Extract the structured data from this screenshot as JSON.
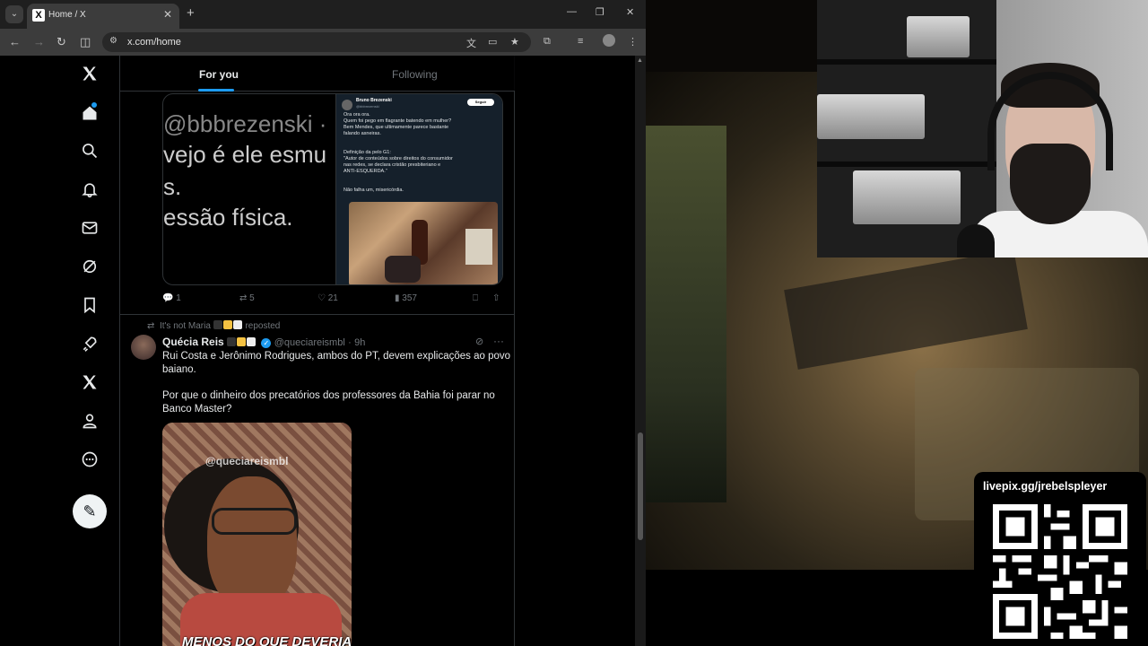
{
  "browser": {
    "tab_title": "Home / X",
    "tab_favicon": "X",
    "new_tab": "+",
    "url": "x.com/home",
    "window_controls": {
      "minimize": "—",
      "maximize": "❐",
      "close": "✕"
    }
  },
  "x": {
    "tabs": {
      "for_you": "For you",
      "following": "Following"
    },
    "nav_icons": [
      "x-logo-icon",
      "home-icon",
      "search-icon",
      "bell-icon",
      "mail-icon",
      "grok-icon",
      "bookmark-icon",
      "rocket-icon",
      "premium-x-icon",
      "profile-icon",
      "more-icon"
    ],
    "compose_icon": "feather-plus-icon",
    "embedded_post": {
      "big_lines": [
        "@bbbrezenski ·",
        "vejo é ele esmu",
        "s.",
        "essão física."
      ],
      "inner_name": "Bruno Brezenski",
      "inner_handle": "@bbbrezenski",
      "inner_follow": "Seguir",
      "inner_lines": [
        "Ora ora ora.",
        "Quem foi pego em flagrante batendo em mulher?",
        "Bem Mendes, que ultimamente parece bastante",
        "falando asneiras.",
        "",
        "Definição da pelo G1:",
        "\"Autor de conteúdos sobre direitos do consumidor",
        "nas redes, se declara cristão presbiteriano e",
        "ANTI-ESQUERDA.\"",
        "",
        "Não falha um, misericórdia."
      ]
    },
    "post1_actions": {
      "replies": "1",
      "reposts": "5",
      "likes": "21",
      "views": "357"
    },
    "post2": {
      "repost_label_user": "It's not Maria",
      "repost_label_suffix": "reposted",
      "author_name": "Quécia Reis",
      "author_handle": "@queciareismbl",
      "time_sep": "·",
      "time": "9h",
      "more": "···",
      "text_lines": [
        "Rui Costa e Jerônimo Rodrigues, ambos do PT, devem explicações ao povo",
        "baiano.",
        "",
        "Por que o dinheiro dos precatórios dos professores da Bahia foi parar no",
        "Banco Master?"
      ],
      "video_watermark": "@queciareismbl",
      "video_caption": "MENOS DO QUE DEVERIA"
    }
  },
  "stream": {
    "livepix_label": "livepix.gg/jrebelspleyer"
  },
  "colors": {
    "accent": "#1d9bf0",
    "x_bg": "#000000",
    "x_border": "#2f3336",
    "muted": "#71767b",
    "chrome_toolbar": "#3c3c3c",
    "chrome_tabstrip": "#1f1f1f"
  }
}
